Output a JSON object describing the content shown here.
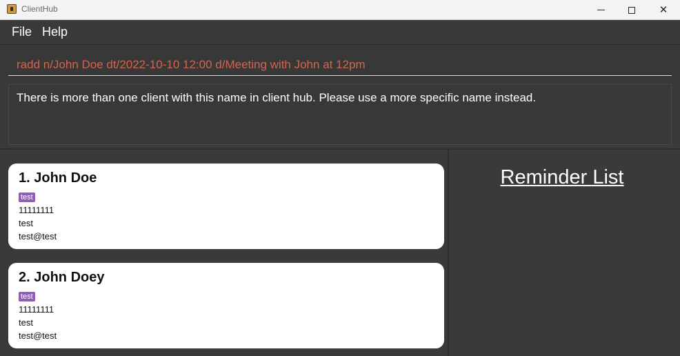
{
  "window": {
    "title": "ClientHub",
    "controls": {
      "minimize": "minimize",
      "maximize": "maximize",
      "close": "✕"
    }
  },
  "menu": {
    "items": [
      {
        "label": "File"
      },
      {
        "label": "Help"
      }
    ]
  },
  "command": {
    "value": "radd n/John Doe dt/2022-10-10 12:00 d/Meeting with John at 12pm"
  },
  "result": {
    "message": "There is more than one client with this name in client hub. Please use a more specific name instead."
  },
  "clients": [
    {
      "name": "1. John Doe",
      "tag": "test",
      "phone": "11111111",
      "address": "test",
      "email": "test@test"
    },
    {
      "name": "2. John Doey",
      "tag": "test",
      "phone": "11111111",
      "address": "test",
      "email": "test@test"
    }
  ],
  "reminders": {
    "title": "Reminder List"
  },
  "colors": {
    "background": "#3a3a3a",
    "command_text": "#d0664f",
    "tag": "#8e5fb5",
    "card": "#ffffff"
  }
}
